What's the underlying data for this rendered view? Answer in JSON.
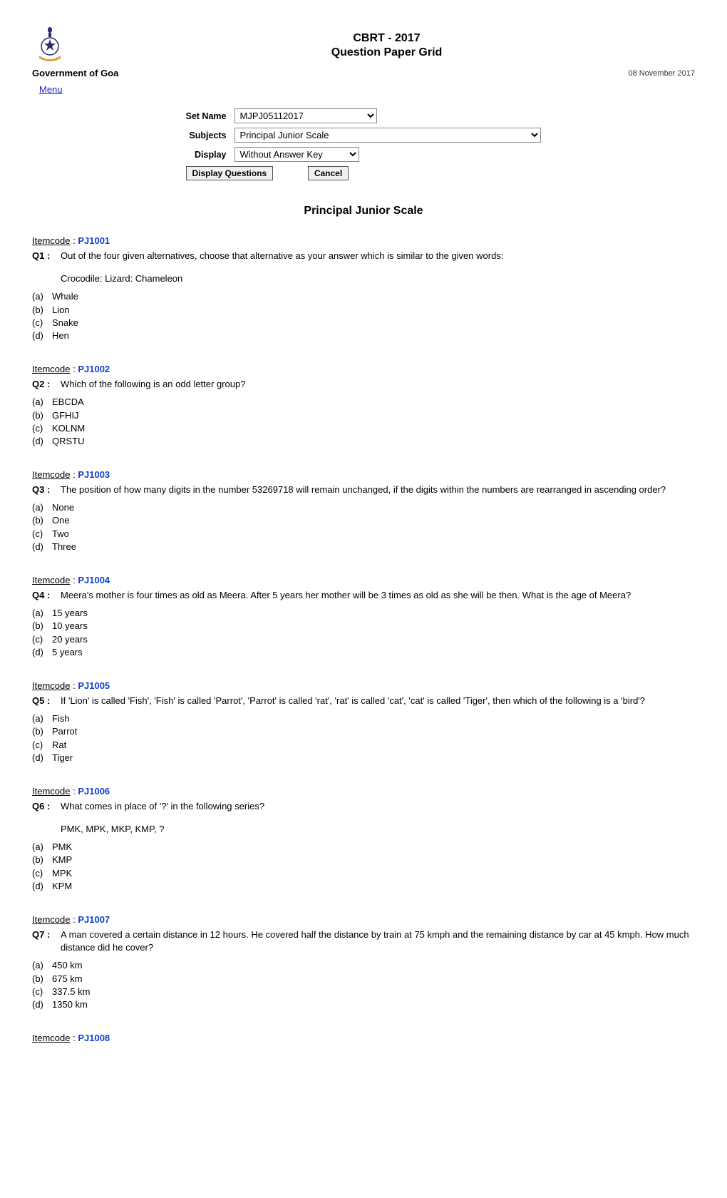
{
  "header": {
    "title_line1": "CBRT - 2017",
    "title_line2": "Question Paper Grid",
    "gov_label": "Government of Goa",
    "date": "08 November 2017",
    "menu_label": "Menu"
  },
  "controls": {
    "setname_label": "Set Name",
    "setname_value": "MJPJ05112017",
    "subjects_label": "Subjects",
    "subjects_value": "Principal Junior Scale",
    "display_label": "Display",
    "display_value": "Without Answer Key",
    "display_btn": "Display Questions",
    "cancel_btn": "Cancel"
  },
  "subject_title": "Principal Junior Scale",
  "itemcode_label": "Itemcode",
  "questions": [
    {
      "code": "PJ1001",
      "num": "Q1 :",
      "text": "Out of the four given alternatives, choose that alternative as your answer which is similar to the given words:",
      "extra": "Crocodile: Lizard: Chameleon",
      "opts": [
        {
          "l": "(a)",
          "t": "Whale"
        },
        {
          "l": "(b)",
          "t": "Lion"
        },
        {
          "l": "(c)",
          "t": "Snake"
        },
        {
          "l": "(d)",
          "t": "Hen"
        }
      ]
    },
    {
      "code": "PJ1002",
      "num": "Q2 :",
      "text": "Which of the following is an odd letter group?",
      "extra": "",
      "opts": [
        {
          "l": "(a)",
          "t": "EBCDA"
        },
        {
          "l": "(b)",
          "t": "GFHIJ"
        },
        {
          "l": "(c)",
          "t": "KOLNM"
        },
        {
          "l": "(d)",
          "t": "QRSTU"
        }
      ]
    },
    {
      "code": "PJ1003",
      "num": "Q3 :",
      "text": "The position of how many digits in the number 53269718 will remain unchanged, if the digits within the numbers are rearranged in ascending order?",
      "extra": "",
      "opts": [
        {
          "l": "(a)",
          "t": "None"
        },
        {
          "l": "(b)",
          "t": "One"
        },
        {
          "l": "(c)",
          "t": "Two"
        },
        {
          "l": "(d)",
          "t": "Three"
        }
      ]
    },
    {
      "code": "PJ1004",
      "num": "Q4 :",
      "text": "Meera's mother is four times as old as Meera. After 5 years her mother will be 3 times as old as she will be then. What is the age of Meera?",
      "extra": "",
      "opts": [
        {
          "l": "(a)",
          "t": "15 years"
        },
        {
          "l": "(b)",
          "t": "10 years"
        },
        {
          "l": "(c)",
          "t": "20 years"
        },
        {
          "l": "(d)",
          "t": "5 years"
        }
      ]
    },
    {
      "code": "PJ1005",
      "num": "Q5 :",
      "text": "If 'Lion' is called 'Fish', 'Fish' is called 'Parrot', 'Parrot' is called 'rat', 'rat' is called 'cat', 'cat' is called 'Tiger', then which of the following is a 'bird'?",
      "extra": "",
      "opts": [
        {
          "l": "(a)",
          "t": "Fish"
        },
        {
          "l": "(b)",
          "t": "Parrot"
        },
        {
          "l": "(c)",
          "t": "Rat"
        },
        {
          "l": "(d)",
          "t": "Tiger"
        }
      ]
    },
    {
      "code": "PJ1006",
      "num": "Q6 :",
      "text": "What comes in place of '?' in the following series?",
      "extra": "PMK, MPK, MKP, KMP, ?",
      "opts": [
        {
          "l": "(a)",
          "t": "PMK"
        },
        {
          "l": "(b)",
          "t": "KMP"
        },
        {
          "l": "(c)",
          "t": "MPK"
        },
        {
          "l": "(d)",
          "t": "KPM"
        }
      ]
    },
    {
      "code": "PJ1007",
      "num": "Q7 :",
      "text": "A man covered a certain distance in 12 hours. He covered half the distance by train at 75 kmph and the remaining distance by car at 45 kmph. How much distance did he cover?",
      "extra": "",
      "opts": [
        {
          "l": "(a)",
          "t": "450 km"
        },
        {
          "l": "(b)",
          "t": "675 km"
        },
        {
          "l": "(c)",
          "t": "337.5 km"
        },
        {
          "l": "(d)",
          "t": "1350 km"
        }
      ]
    },
    {
      "code": "PJ1008",
      "num": "",
      "text": "",
      "extra": "",
      "opts": []
    }
  ]
}
